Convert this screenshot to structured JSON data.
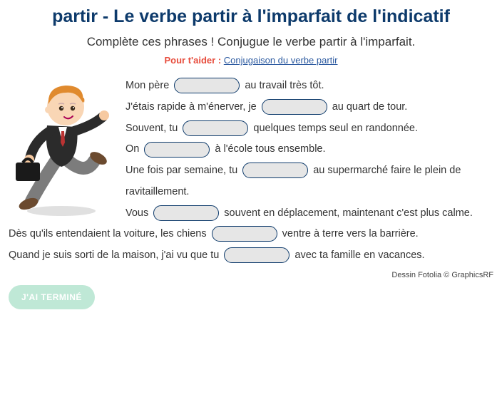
{
  "title": "partir - Le verbe partir à l'imparfait de l'indicatif",
  "subtitle": "Complète ces phrases ! Conjugue le verbe partir à l'imparfait.",
  "helper": {
    "label": "Pour t'aider : ",
    "link_text": "Conjugaison du verbe partir"
  },
  "sentences": [
    {
      "before": "Mon père ",
      "after": " au travail très tôt."
    },
    {
      "before": "J'étais rapide à m'énerver, je ",
      "after": " au quart de tour."
    },
    {
      "before": "Souvent, tu ",
      "after": " quelques temps seul en randonnée."
    },
    {
      "before": "On ",
      "after": " à l'école tous ensemble."
    },
    {
      "before": "Une fois par semaine, tu ",
      "after": " au supermarché faire le plein de ravitaillement."
    },
    {
      "before": "Vous ",
      "after": " souvent en déplacement, maintenant c'est plus calme."
    },
    {
      "before": "Dès qu'ils entendaient la voiture, les chiens ",
      "after": " ventre à terre vers la barrière."
    },
    {
      "before": "Quand je suis sorti de la maison, j'ai vu que tu ",
      "after": " avec ta famille en vacances."
    }
  ],
  "credit": "Dessin Fotolia © GraphicsRF",
  "button_label": "J'AI TERMINÉ"
}
